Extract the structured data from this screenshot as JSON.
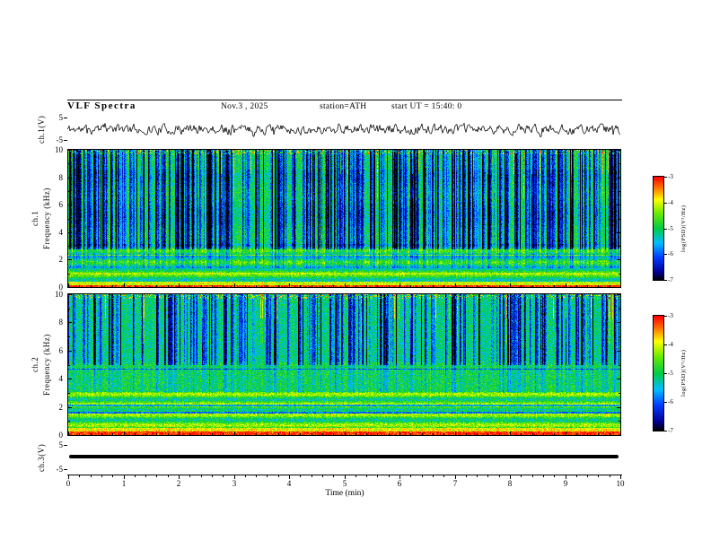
{
  "header": {
    "title": "VLF  Spectra",
    "date": "Nov.3 , 2025",
    "station": "station=ATH",
    "start_ut": "start UT =  15:40: 0"
  },
  "xaxis": {
    "label": "Time  (min)",
    "range": [
      0,
      10
    ],
    "ticks": [
      0,
      1,
      2,
      3,
      4,
      5,
      6,
      7,
      8,
      9,
      10
    ],
    "minor_step": 0.2
  },
  "panels": {
    "ch1_wave": {
      "ylabel": "ch.1(V)",
      "ytick_top": "5",
      "ytick_bottom": "-5",
      "y_range": [
        -5,
        5
      ]
    },
    "ch1_spec": {
      "ylabel1": "ch.1",
      "ylabel2": "Frequency  (kHz)",
      "yticks": [
        0,
        2,
        4,
        6,
        8,
        10
      ],
      "y_range": [
        0,
        10
      ]
    },
    "ch2_spec": {
      "ylabel1": "ch.2",
      "ylabel2": "Frequency  (kHz)",
      "yticks": [
        0,
        2,
        4,
        6,
        8,
        10
      ],
      "y_range": [
        0,
        10
      ]
    },
    "ch3_wave": {
      "ylabel": "ch.3(V)",
      "ytick_top": "5",
      "ytick_bottom": "-5",
      "y_range": [
        -5,
        5
      ]
    }
  },
  "colorbars": {
    "label": "log(PSD)(V²/Hz)",
    "ticks": [
      "-3",
      "-4",
      "-5",
      "-6",
      "-7"
    ],
    "range": [
      -7,
      -3
    ]
  },
  "colors": {
    "colormap_hex": [
      "#000000",
      "#000096",
      "#003cff",
      "#00beff",
      "#00cd46",
      "#6eeb00",
      "#ffff00",
      "#ff7800",
      "#ff0000"
    ],
    "frame": "#000000",
    "background": "#ffffff"
  },
  "chart_data": [
    {
      "type": "line",
      "name": "ch1_voltage_waveform",
      "ylabel": "ch.1(V)",
      "y_range": [
        -5,
        5
      ],
      "x_range": [
        0,
        10
      ],
      "description": "Continuous noisy black voltage trace spanning full 10 min, amplitude roughly ±4 V about 0"
    },
    {
      "type": "heatmap",
      "name": "ch1_spectrogram",
      "x_range": [
        0,
        10
      ],
      "xlabel": "Time (min)",
      "y_range": [
        0,
        10
      ],
      "ylabel": "ch.1 Frequency (kHz)",
      "z_label": "log(PSD)(V²/Hz)",
      "z_range": [
        -7,
        -3
      ],
      "features": [
        "red band below ~0.2 kHz (PSD ~ -3)",
        "yellow/orange band ~0.2-0.5 kHz",
        "alternating yellow-green horizontal bands 0.5-3 kHz",
        "green background ~ -5 above 3 kHz",
        "dense dark-blue vertical dropout streaks above ~3 kHz across whole record",
        "scattered warm (orange/red) speckle near 9-10 kHz"
      ]
    },
    {
      "type": "heatmap",
      "name": "ch2_spectrogram",
      "x_range": [
        0,
        10
      ],
      "xlabel": "Time (min)",
      "y_range": [
        0,
        10
      ],
      "ylabel": "ch.2 Frequency (kHz)",
      "z_label": "log(PSD)(V²/Hz)",
      "z_range": [
        -7,
        -3
      ],
      "features": [
        "thicker red band below ~0.35 kHz",
        "strong yellow and dark horizontal banding 0.5-3 kHz",
        "thin dark line near 4.7 kHz",
        "green background with blue vertical streaks mostly above ~5 kHz"
      ]
    },
    {
      "type": "line",
      "name": "ch3_voltage_waveform",
      "ylabel": "ch.3(V)",
      "y_range": [
        -5,
        5
      ],
      "x_range": [
        0,
        10
      ],
      "description": "Flat thick black line at 0 V across full record"
    }
  ]
}
